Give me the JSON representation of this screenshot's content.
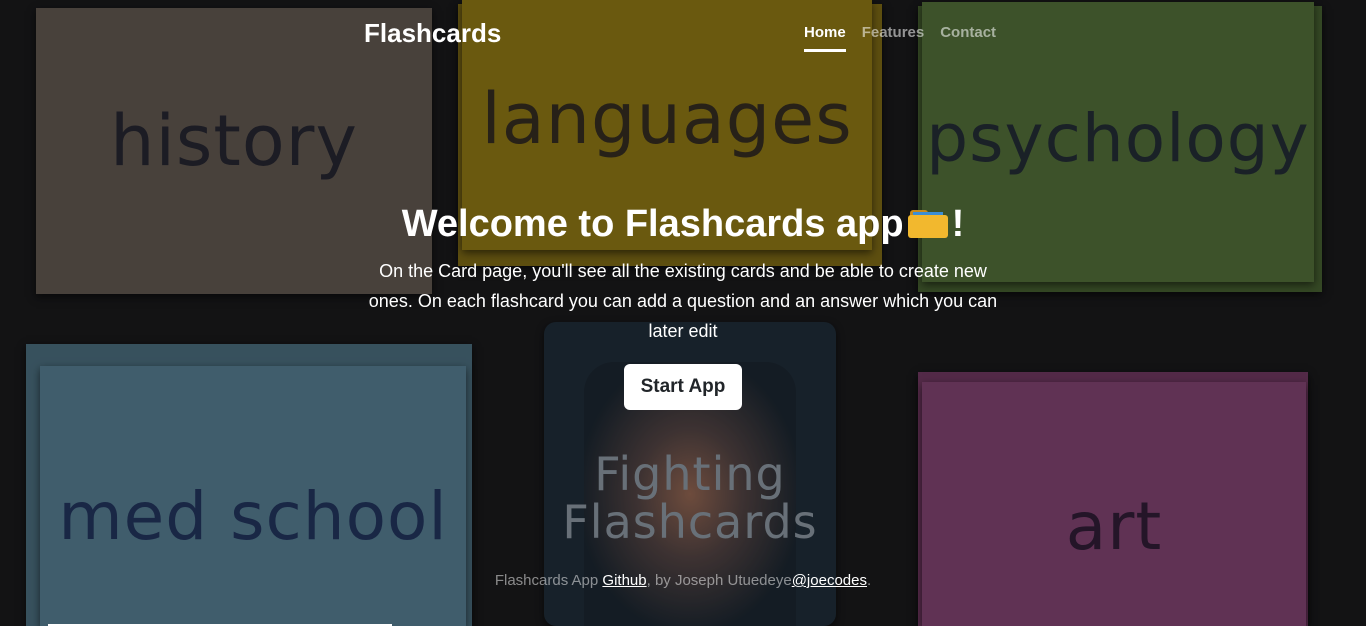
{
  "navbar": {
    "brand": "Flashcards",
    "links": [
      {
        "label": "Home",
        "active": true
      },
      {
        "label": "Features",
        "active": false
      },
      {
        "label": "Contact",
        "active": false
      }
    ]
  },
  "background": {
    "cards": [
      "history",
      "languages",
      "psychology",
      "med school",
      "Fighting Flashcards",
      "art"
    ]
  },
  "hero": {
    "title_before": "Welcome to Flashcards app",
    "title_icon": "folder-icon",
    "title_after": "!",
    "description": "On the Card page, you'll see all the existing cards and be able to create new ones. On each flashcard you can add a question and an answer which you can later edit",
    "button_label": "Start App"
  },
  "footer": {
    "prefix": "Flashcards App ",
    "github_label": "Github",
    "middle": ", by Joseph Utuedeye",
    "handle_label": "@joecodes",
    "suffix": "."
  },
  "colors": {
    "overlay": "#000000",
    "text": "#ffffff",
    "nav_inactive": "#8c8c8c",
    "button_bg": "#ffffff",
    "button_text": "#212529"
  }
}
